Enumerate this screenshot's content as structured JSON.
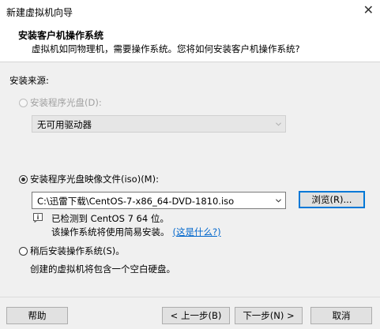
{
  "window": {
    "title": "新建虚拟机向导",
    "close_glyph": "✕"
  },
  "header": {
    "title": "安装客户机操作系统",
    "subtitle": "虚拟机如同物理机，需要操作系统。您将如何安装客户机操作系统?"
  },
  "install_source": {
    "label": "安装来源:",
    "disc_option": {
      "label": "安装程序光盘(D):",
      "enabled": false,
      "selected": false
    },
    "disc_drive_select": {
      "value": "无可用驱动器",
      "enabled": false
    },
    "iso_option": {
      "label": "安装程序光盘映像文件(iso)(M):",
      "selected": true
    },
    "iso_path": {
      "value": "C:\\迅雷下载\\CentOS-7-x86_64-DVD-1810.iso"
    },
    "browse_button": "浏览(R)...",
    "detect_message": "已检测到 CentOS 7 64 位。",
    "easy_install_message": "该操作系统将使用简易安装。",
    "whats_this_link": "(这是什么?)",
    "later_option": {
      "label": "稍后安装操作系统(S)。",
      "selected": false
    },
    "later_description": "创建的虚拟机将包含一个空白硬盘。"
  },
  "footer": {
    "help": "帮助",
    "back": "< 上一步(B)",
    "next": "下一步(N) >",
    "cancel": "取消"
  },
  "icons": {
    "info": "info-icon",
    "dropdown": "chevron-down-icon"
  },
  "colors": {
    "accent": "#0078d7",
    "link": "#0066cc"
  }
}
